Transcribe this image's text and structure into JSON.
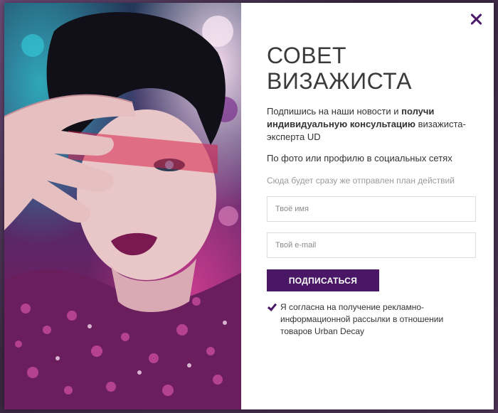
{
  "colors": {
    "accent": "#4a1766",
    "close": "#4b1a6a",
    "text": "#333333",
    "muted": "#9a9a9a",
    "border": "#dcdcdc"
  },
  "icons": {
    "close": "close-icon",
    "checkbox": "checkmark-icon"
  },
  "modal": {
    "title_line1": "Совет",
    "title_line2": "визажиста",
    "lead_part1": "Подпишись на наши новости и ",
    "lead_bold": "получи индивидуальную консультацию",
    "lead_part2": " визажиста-эксперта UD",
    "subtext": "По фото или профилю в социальных сетях",
    "note": "Сюда будет сразу же отправлен план действий",
    "name_field": {
      "placeholder": "Твоё имя",
      "value": ""
    },
    "email_field": {
      "placeholder": "Твой e-mail",
      "value": ""
    },
    "submit_label": "Подписаться",
    "consent": {
      "checked": true,
      "label": "Я согласна на получение рекламно-информационной рассылки в отношении товаров Urban Decay"
    }
  }
}
